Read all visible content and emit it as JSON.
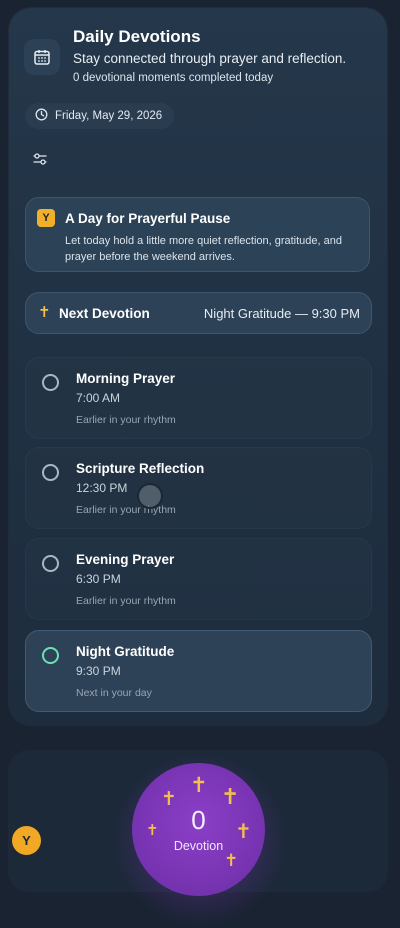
{
  "header": {
    "icon": "calendar-icon",
    "title": "Daily Devotions",
    "subtitle": "Stay connected through prayer and reflection.",
    "progress_note": "0 devotional moments completed today"
  },
  "date_pill": {
    "icon": "clock-icon",
    "text": "Friday, May 29, 2026"
  },
  "filter": {
    "icon": "sliders-icon"
  },
  "message": {
    "badge": "Y",
    "title": "A Day for Prayerful Pause",
    "body": "Let today hold a little more quiet reflection, gratitude, and prayer before the weekend arrives."
  },
  "next_devotion": {
    "icon": "cross-icon",
    "label": "Next Devotion",
    "value": "Night Gratitude — 9:30 PM"
  },
  "devotions": [
    {
      "name": "Morning Prayer",
      "time": "7:00 AM",
      "note": "Earlier in your rhythm"
    },
    {
      "name": "Scripture Reflection",
      "time": "12:30 PM",
      "note": "Earlier in your rhythm"
    },
    {
      "name": "Evening Prayer",
      "time": "6:30 PM",
      "note": "Earlier in your rhythm"
    },
    {
      "name": "Night Gratitude",
      "time": "9:30 PM",
      "note": "Next in your day"
    }
  ],
  "orb": {
    "count": "0",
    "label": "Devotion",
    "cross": "✝"
  },
  "avatar": {
    "initial": "Y"
  },
  "colors": {
    "accent_gold": "#f3c04b",
    "accent_purple": "#8b3fc7",
    "active_ring": "#6fe0b0"
  }
}
